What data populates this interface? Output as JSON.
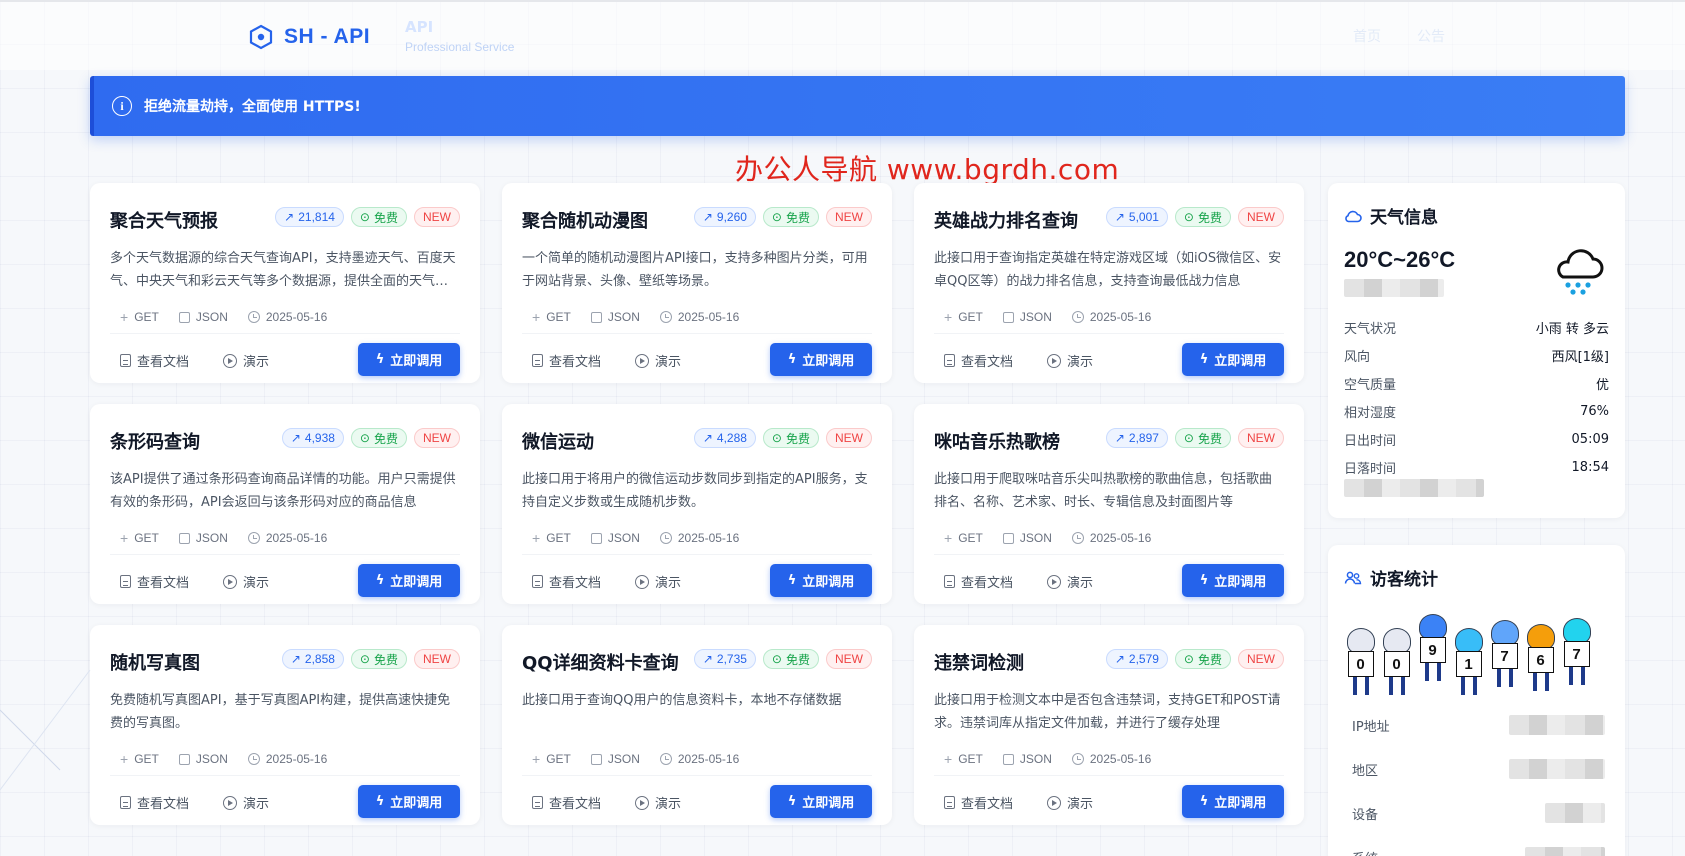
{
  "header": {
    "logo_text": "SH - API",
    "sub_title": "API",
    "sub_tagline": "Professional Service",
    "nav": [
      "首页",
      "公告"
    ]
  },
  "notice": {
    "icon": "info-icon",
    "text": "拒绝流量劫持，全面使用 HTTPS!"
  },
  "watermark": "办公人导航  www.bgrdh.com",
  "labels": {
    "free": "免费",
    "new": "NEW",
    "method": "GET",
    "format": "JSON",
    "docs": "查看文档",
    "demo": "演示",
    "invoke": "立即调用"
  },
  "cards": [
    {
      "title": "聚合天气预报",
      "views": "21,814",
      "desc": "多个天气数据源的综合天气查询API，支持墨迹天气、百度天气、中央天气和彩云天气等多个数据源，提供全面的天气信息",
      "date": "2025-05-16"
    },
    {
      "title": "聚合随机动漫图",
      "views": "9,260",
      "desc": "一个简单的随机动漫图片API接口，支持多种图片分类，可用于网站背景、头像、壁纸等场景。",
      "date": "2025-05-16"
    },
    {
      "title": "英雄战力排名查询",
      "views": "5,001",
      "desc": "此接口用于查询指定英雄在特定游戏区域（如iOS微信区、安卓QQ区等）的战力排名信息，支持查询最低战力信息",
      "date": "2025-05-16"
    },
    {
      "title": "条形码查询",
      "views": "4,938",
      "desc": "该API提供了通过条形码查询商品详情的功能。用户只需提供有效的条形码，API会返回与该条形码对应的商品信息",
      "date": "2025-05-16"
    },
    {
      "title": "微信运动",
      "views": "4,288",
      "desc": "此接口用于将用户的微信运动步数同步到指定的API服务，支持自定义步数或生成随机步数。",
      "date": "2025-05-16"
    },
    {
      "title": "咪咕音乐热歌榜",
      "views": "2,897",
      "desc": "此接口用于爬取咪咕音乐尖叫热歌榜的歌曲信息，包括歌曲排名、名称、艺术家、时长、专辑信息及封面图片等",
      "date": "2025-05-16"
    },
    {
      "title": "随机写真图",
      "views": "2,858",
      "desc": "免费随机写真图API，基于写真图API构建，提供高速快捷免费的写真图。",
      "date": "2025-05-16"
    },
    {
      "title": "QQ详细资料卡查询",
      "views": "2,735",
      "desc": "此接口用于查询QQ用户的信息资料卡，本地不存储数据",
      "date": "2025-05-16"
    },
    {
      "title": "违禁词检测",
      "views": "2,579",
      "desc": "此接口用于检测文本中是否包含违禁词，支持GET和POST请求。违禁词库从指定文件加载，并进行了缓存处理",
      "date": "2025-05-16"
    }
  ],
  "weather": {
    "title": "天气信息",
    "icon": "cloud-icon",
    "temp": "20°C~26°C",
    "condition_icon": "rain-cloud-icon",
    "rows": [
      {
        "k": "天气状况",
        "v": "小雨 转 多云"
      },
      {
        "k": "风向",
        "v": "西风[1级]"
      },
      {
        "k": "空气质量",
        "v": "优"
      },
      {
        "k": "相对湿度",
        "v": "76%"
      },
      {
        "k": "日出时间",
        "v": "05:09"
      },
      {
        "k": "日落时间",
        "v": "18:54"
      }
    ]
  },
  "visitor": {
    "title": "访客统计",
    "icon": "users-icon",
    "counter_digits": [
      "0",
      "0",
      "9",
      "1",
      "7",
      "6",
      "7"
    ],
    "rows": [
      {
        "k": "IP地址"
      },
      {
        "k": "地区"
      },
      {
        "k": "设备"
      },
      {
        "k": "系统"
      }
    ]
  },
  "colors": {
    "accent": "#2563eb",
    "free": "#16a34a",
    "new": "#ef4444",
    "watermark": "#e0261d"
  }
}
